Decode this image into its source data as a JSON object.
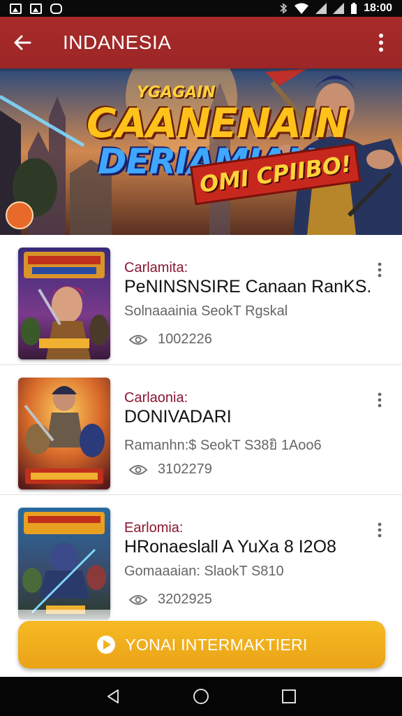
{
  "status_bar": {
    "time": "18:00",
    "left_icons": [
      "image-icon",
      "gallery-icon",
      "camera-icon"
    ],
    "right_icons": [
      "bluetooth-icon",
      "wifi-icon",
      "signal-icon",
      "signal-icon",
      "battery-icon"
    ]
  },
  "app_bar": {
    "title": "INDANESIA",
    "back_icon": "arrow-left-icon",
    "menu_icon": "more-vert-icon",
    "color": "#a52a2a"
  },
  "banner": {
    "small_text": "YGAGAIN",
    "line1": "CAANENAIN",
    "line2": "DERIAMIAN",
    "ribbon": "OMI CPIIBO!"
  },
  "items": [
    {
      "category": "Carlamita:",
      "title": "PeNINSNSIRE Canaan RanKS.",
      "subtitle": "Solnaaainia SeokT Rgskal",
      "views": "1002226",
      "views_icon": "eye-icon",
      "menu_icon": "more-vert-icon"
    },
    {
      "category": "Carlaonia:",
      "title": "DONIVADARI",
      "subtitle": "Ramanhn:$ SeokT S38ยิ 1Aoo6",
      "views": "3102279",
      "views_icon": "eye-icon",
      "menu_icon": "more-vert-icon"
    },
    {
      "category": "Earlomia:",
      "title": "HRonaeslall A YuXa 8 I2O8",
      "subtitle": "Gomaaaian: SlaokT S810",
      "views": "3202925",
      "views_icon": "eye-icon",
      "menu_icon": "more-vert-icon"
    }
  ],
  "cta": {
    "label": "YONAI INTERMAKTIERI",
    "icon": "play-icon",
    "color": "#f3b11c"
  },
  "nav": {
    "back_icon": "nav-back-icon",
    "home_icon": "nav-home-icon",
    "recents_icon": "nav-recents-icon"
  }
}
